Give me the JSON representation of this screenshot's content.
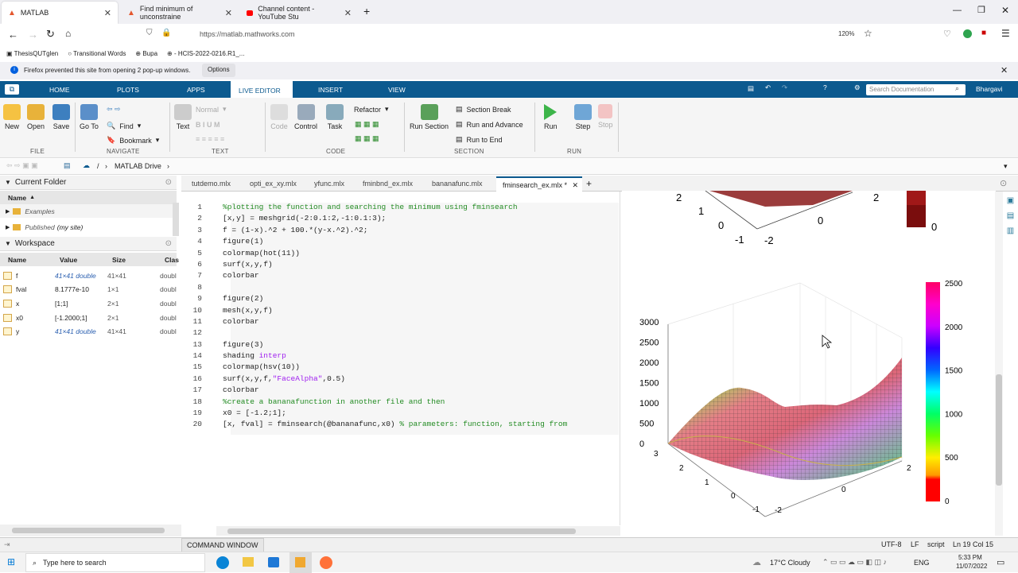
{
  "browser": {
    "tabs": [
      {
        "label": "MATLAB",
        "active": true
      },
      {
        "label": "Find minimum of unconstraine",
        "active": false
      },
      {
        "label": "Channel content - YouTube Stu",
        "active": false
      }
    ],
    "url": "https://matlab.mathworks.com",
    "zoom": "120%",
    "bookmarks": [
      "ThesisQUTglen",
      "Transitional Words",
      "Bupa",
      "- HCIS-2022-0216.R1_..."
    ],
    "notification": "Firefox prevented this site from opening 2 pop-up windows.",
    "notification_button": "Options"
  },
  "matlab": {
    "logo": "MATLAB",
    "tabs": [
      "HOME",
      "PLOTS",
      "APPS",
      "LIVE EDITOR",
      "INSERT",
      "VIEW"
    ],
    "active_tab": "LIVE EDITOR",
    "search_placeholder": "Search Documentation",
    "user": "Bhargavi",
    "ribbon": {
      "new": "New",
      "open": "Open",
      "save": "Save",
      "file_group": "FILE",
      "goto": "Go To",
      "find": "Find",
      "bookmark": "Bookmark",
      "navigate_group": "NAVIGATE",
      "text": "Text",
      "normal": "Normal",
      "text_group": "TEXT",
      "code": "Code",
      "control": "Control",
      "task": "Task",
      "refactor": "Refactor",
      "code_group": "CODE",
      "run_section": "Run Section",
      "section_break": "Section Break",
      "run_advance": "Run and Advance",
      "run_to_end": "Run to End",
      "section_group": "SECTION",
      "run": "Run",
      "step": "Step",
      "stop": "Stop",
      "run_group": "RUN"
    },
    "path": [
      "/",
      "MATLAB Drive"
    ],
    "current_folder": {
      "title": "Current Folder",
      "name_header": "Name",
      "items": [
        "Examples",
        "Published"
      ],
      "published_suffix": "(my site)"
    },
    "workspace": {
      "title": "Workspace",
      "headers": [
        "Name",
        "Value",
        "Size",
        "Clas"
      ],
      "rows": [
        {
          "name": "f",
          "value": "41×41 double",
          "size": "41×41",
          "class": "double"
        },
        {
          "name": "fval",
          "value": "8.1777e-10",
          "size": "1×1",
          "class": "double"
        },
        {
          "name": "x",
          "value": "[1;1]",
          "size": "2×1",
          "class": "double"
        },
        {
          "name": "x0",
          "value": "[-1.2000;1]",
          "size": "2×1",
          "class": "double"
        },
        {
          "name": "y",
          "value": "41×41 double",
          "size": "41×41",
          "class": "double"
        }
      ]
    },
    "editor_tabs": [
      "tutdemo.mlx",
      "opti_ex_xy.mlx",
      "yfunc.mlx",
      "fminbnd_ex.mlx",
      "bananafunc.mlx",
      "fminsearch_ex.mlx *"
    ],
    "code_lines": [
      [
        "1",
        "%plotting the function and searching the minimum using fminsearch"
      ],
      [
        "2",
        "[x,y] = meshgrid(-2:0.1:2,-1:0.1:3);"
      ],
      [
        "3",
        "f = (1-x).^2 + 100.*(y-x.^2).^2;"
      ],
      [
        "4",
        "figure(1)"
      ],
      [
        "5",
        "colormap(hot(11))"
      ],
      [
        "6",
        "surf(x,y,f)"
      ],
      [
        "7",
        "colorbar"
      ],
      [
        "8",
        ""
      ],
      [
        "9",
        "figure(2)"
      ],
      [
        "10",
        "mesh(x,y,f)"
      ],
      [
        "11",
        "colorbar"
      ],
      [
        "12",
        ""
      ],
      [
        "13",
        "figure(3)"
      ],
      [
        "14",
        "shading interp"
      ],
      [
        "15",
        "colormap(hsv(10))"
      ],
      [
        "16",
        "surf(x,y,f,\"FaceAlpha\",0.5)"
      ],
      [
        "17",
        "colorbar"
      ],
      [
        "18",
        "%create a bananafunction in another file and then"
      ],
      [
        "19",
        "x0 = [-1.2;1];"
      ],
      [
        "20",
        "[x, fval] = fminsearch(@bananafunc,x0) % parameters: function, starting from"
      ]
    ],
    "command_window": "COMMAND WINDOW",
    "status": {
      "encoding": "UTF-8",
      "eol": "LF",
      "mode": "script",
      "position": "Ln 19 Col 15"
    }
  },
  "figure": {
    "top_ticks": [
      "2",
      "1",
      "0",
      "-1",
      "-2",
      "0",
      "2",
      "0"
    ],
    "zticks": [
      "3000",
      "2500",
      "2000",
      "1500",
      "1000",
      "500",
      "0"
    ],
    "yticks": [
      "3",
      "2",
      "1",
      "0",
      "-1"
    ],
    "xticks": [
      "-2",
      "0",
      "2"
    ],
    "colorbar": [
      "2500",
      "2000",
      "1500",
      "1000",
      "500",
      "0"
    ]
  },
  "taskbar": {
    "search": "Type here to search",
    "weather": "17°C  Cloudy",
    "lang": "ENG",
    "time": "5:33 PM",
    "date": "11/07/2022"
  }
}
